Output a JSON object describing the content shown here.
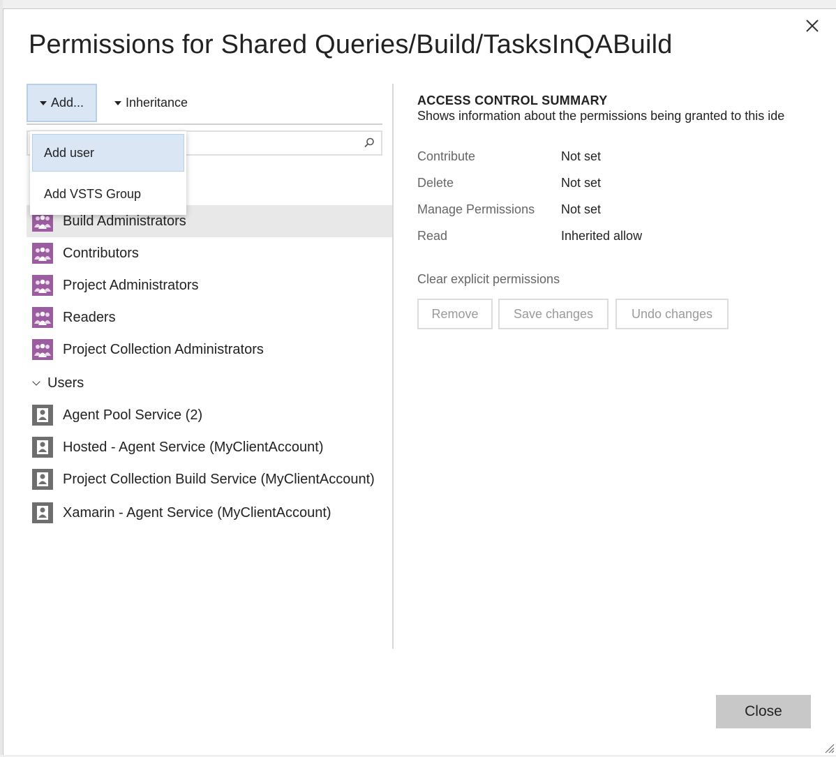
{
  "dialog": {
    "title": "Permissions for Shared Queries/Build/TasksInQABuild",
    "close_icon": "close-icon",
    "close_button": "Close"
  },
  "toolbar": {
    "add_label": "Add...",
    "inheritance_label": "Inheritance"
  },
  "search": {
    "placeholder": "",
    "icon": "search-icon"
  },
  "add_menu": {
    "items": [
      {
        "label": "Add user",
        "selected": true
      },
      {
        "label": "Add VSTS Group",
        "selected": false
      }
    ]
  },
  "groups": {
    "items": [
      {
        "label": "Build Administrators",
        "icon": "group-icon",
        "highlighted": true
      },
      {
        "label": "Contributors",
        "icon": "group-icon"
      },
      {
        "label": "Project Administrators",
        "icon": "group-icon"
      },
      {
        "label": "Readers",
        "icon": "group-icon"
      },
      {
        "label": "Project Collection Administrators",
        "icon": "group-icon"
      }
    ]
  },
  "users": {
    "header": "Users",
    "items": [
      {
        "label": "Agent Pool Service (2)",
        "icon": "user-icon"
      },
      {
        "label": "Hosted - Agent Service (MyClientAccount)",
        "icon": "user-icon"
      },
      {
        "label": "Project Collection Build Service (MyClientAccount)",
        "icon": "user-icon"
      },
      {
        "label": "Xamarin - Agent Service (MyClientAccount)",
        "icon": "user-icon"
      }
    ]
  },
  "summary": {
    "title": "ACCESS CONTROL SUMMARY",
    "subtitle": "Shows information about the permissions being granted to this ide",
    "permissions": [
      {
        "name": "Contribute",
        "value": "Not set"
      },
      {
        "name": "Delete",
        "value": "Not set"
      },
      {
        "name": "Manage Permissions",
        "value": "Not set"
      },
      {
        "name": "Read",
        "value": "Inherited allow"
      }
    ],
    "clear_link": "Clear explicit permissions",
    "buttons": {
      "remove": "Remove",
      "save": "Save changes",
      "undo": "Undo changes"
    }
  },
  "colors": {
    "accent_bg": "#dbe6f4",
    "group_icon": "#9c5ca0",
    "user_icon": "#6e6e6e"
  }
}
